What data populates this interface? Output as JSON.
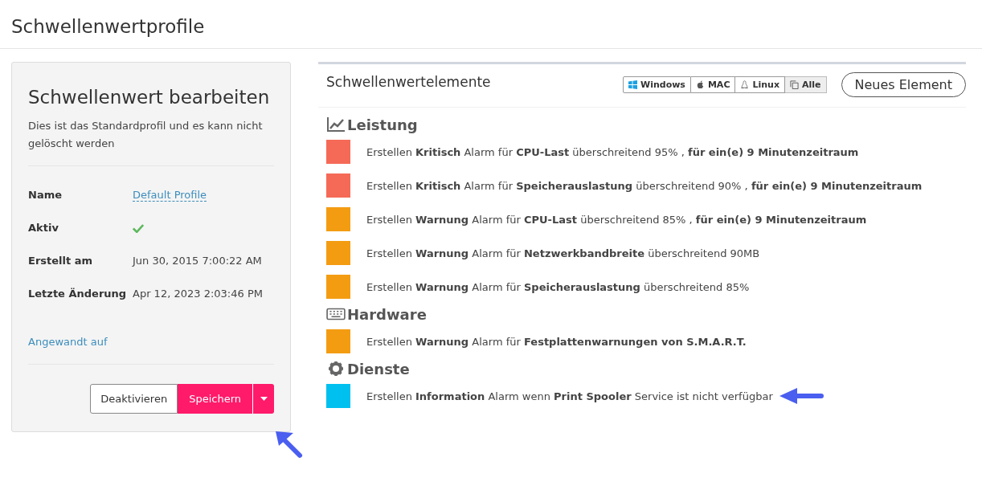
{
  "page_title": "Schwellenwertprofile",
  "editor": {
    "title": "Schwellenwert bearbeiten",
    "description": "Dies ist das Standardprofil und es kann nicht gelöscht werden",
    "fields": [
      {
        "label": "Name",
        "kind": "link",
        "value": "Default Profile"
      },
      {
        "label": "Aktiv",
        "kind": "check",
        "checked": true
      },
      {
        "label": "Erstellt am",
        "kind": "text",
        "value": "Jun 30, 2015 7:00:22 AM"
      },
      {
        "label": "Letzte Änderung",
        "kind": "text",
        "value": "Apr 12, 2023 2:03:46 PM"
      }
    ],
    "applied_link": "Angewandt auf",
    "buttons": {
      "deactivate": "Deaktivieren",
      "save": "Speichern"
    }
  },
  "elements": {
    "title": "Schwellenwertelemente",
    "filters": [
      {
        "label": "Windows",
        "kind": "windows",
        "selected": false
      },
      {
        "label": "MAC",
        "kind": "apple",
        "selected": false
      },
      {
        "label": "Linux",
        "kind": "linux",
        "selected": false
      },
      {
        "label": "Alle",
        "kind": "all",
        "selected": true
      }
    ],
    "new_button": "Neues Element",
    "groups": [
      {
        "name": "Leistung",
        "kind": "chart",
        "items": [
          {
            "color": "#f56a57",
            "text": "Erstellen **Kritisch** Alarm für **CPU-Last** überschreitend 95% , **für ein(e) 9 Minutenzeitraum**"
          },
          {
            "color": "#f56a57",
            "text": "Erstellen **Kritisch** Alarm für **Speicherauslastung** überschreitend 90% , **für ein(e) 9 Minutenzeitraum**"
          },
          {
            "color": "#f39c12",
            "text": "Erstellen **Warnung** Alarm für **CPU-Last** überschreitend 85% , **für ein(e) 9 Minutenzeitraum**"
          },
          {
            "color": "#f39c12",
            "text": "Erstellen **Warnung** Alarm für **Netzwerkbandbreite** überschreitend 90MB"
          },
          {
            "color": "#f39c12",
            "text": "Erstellen **Warnung** Alarm für **Speicherauslastung** überschreitend 85%"
          }
        ]
      },
      {
        "name": "Hardware",
        "kind": "keyboard",
        "items": [
          {
            "color": "#f39c12",
            "text": "Erstellen **Warnung** Alarm für **Festplattenwarnungen von S.M.A.R.T.**"
          }
        ]
      },
      {
        "name": "Dienste",
        "kind": "gear",
        "items": [
          {
            "color": "#00c0ef",
            "text": "Erstellen **Information** Alarm wenn **Print Spooler** Service ist nicht verfügbar"
          }
        ]
      }
    ]
  }
}
